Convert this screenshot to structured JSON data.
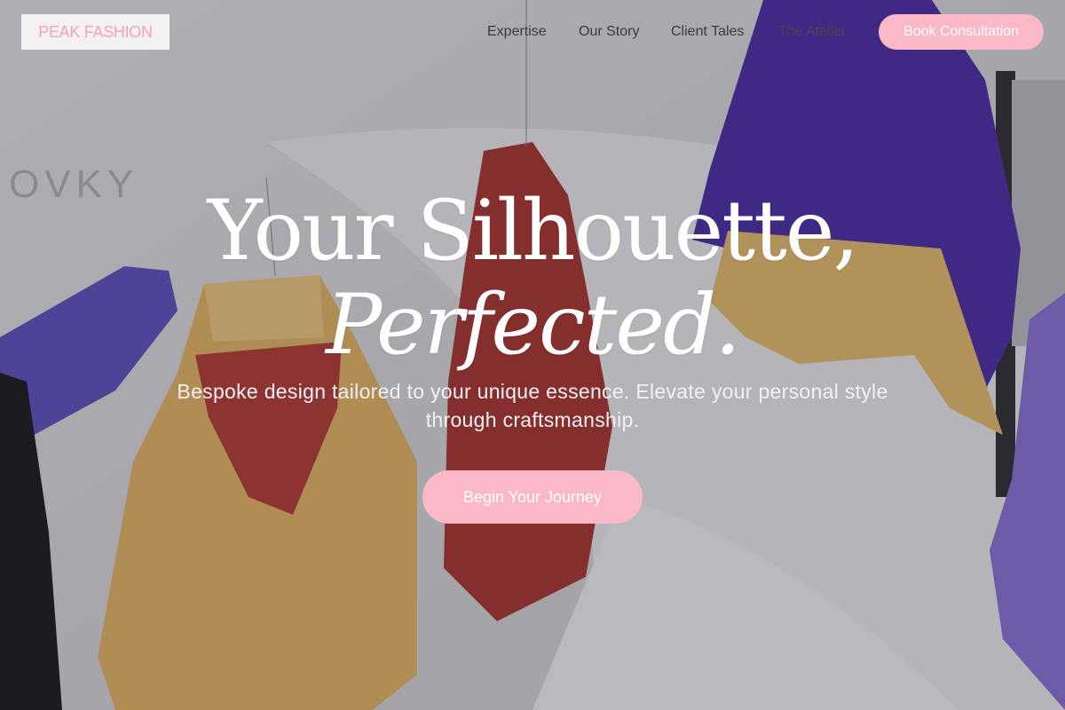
{
  "brand": {
    "logo_text": "PEAK FASHION"
  },
  "nav": {
    "links": [
      "Expertise",
      "Our Story",
      "Client Tales",
      "The Atelier"
    ],
    "cta_label": "Book Consultation"
  },
  "hero": {
    "title_line1": "Your Silhouette,",
    "title_line2": "Perfected.",
    "subtitle": "Bespoke design tailored to your unique essence. Elevate your personal style through craftsmanship.",
    "cta_label": "Begin Your Journey"
  },
  "colors": {
    "accent": "#fbb8c6",
    "logo_text": "#f6a3b5",
    "heading": "#ffffff"
  },
  "background": {
    "scene": "hanging-jackets-photo",
    "icon_names": []
  }
}
